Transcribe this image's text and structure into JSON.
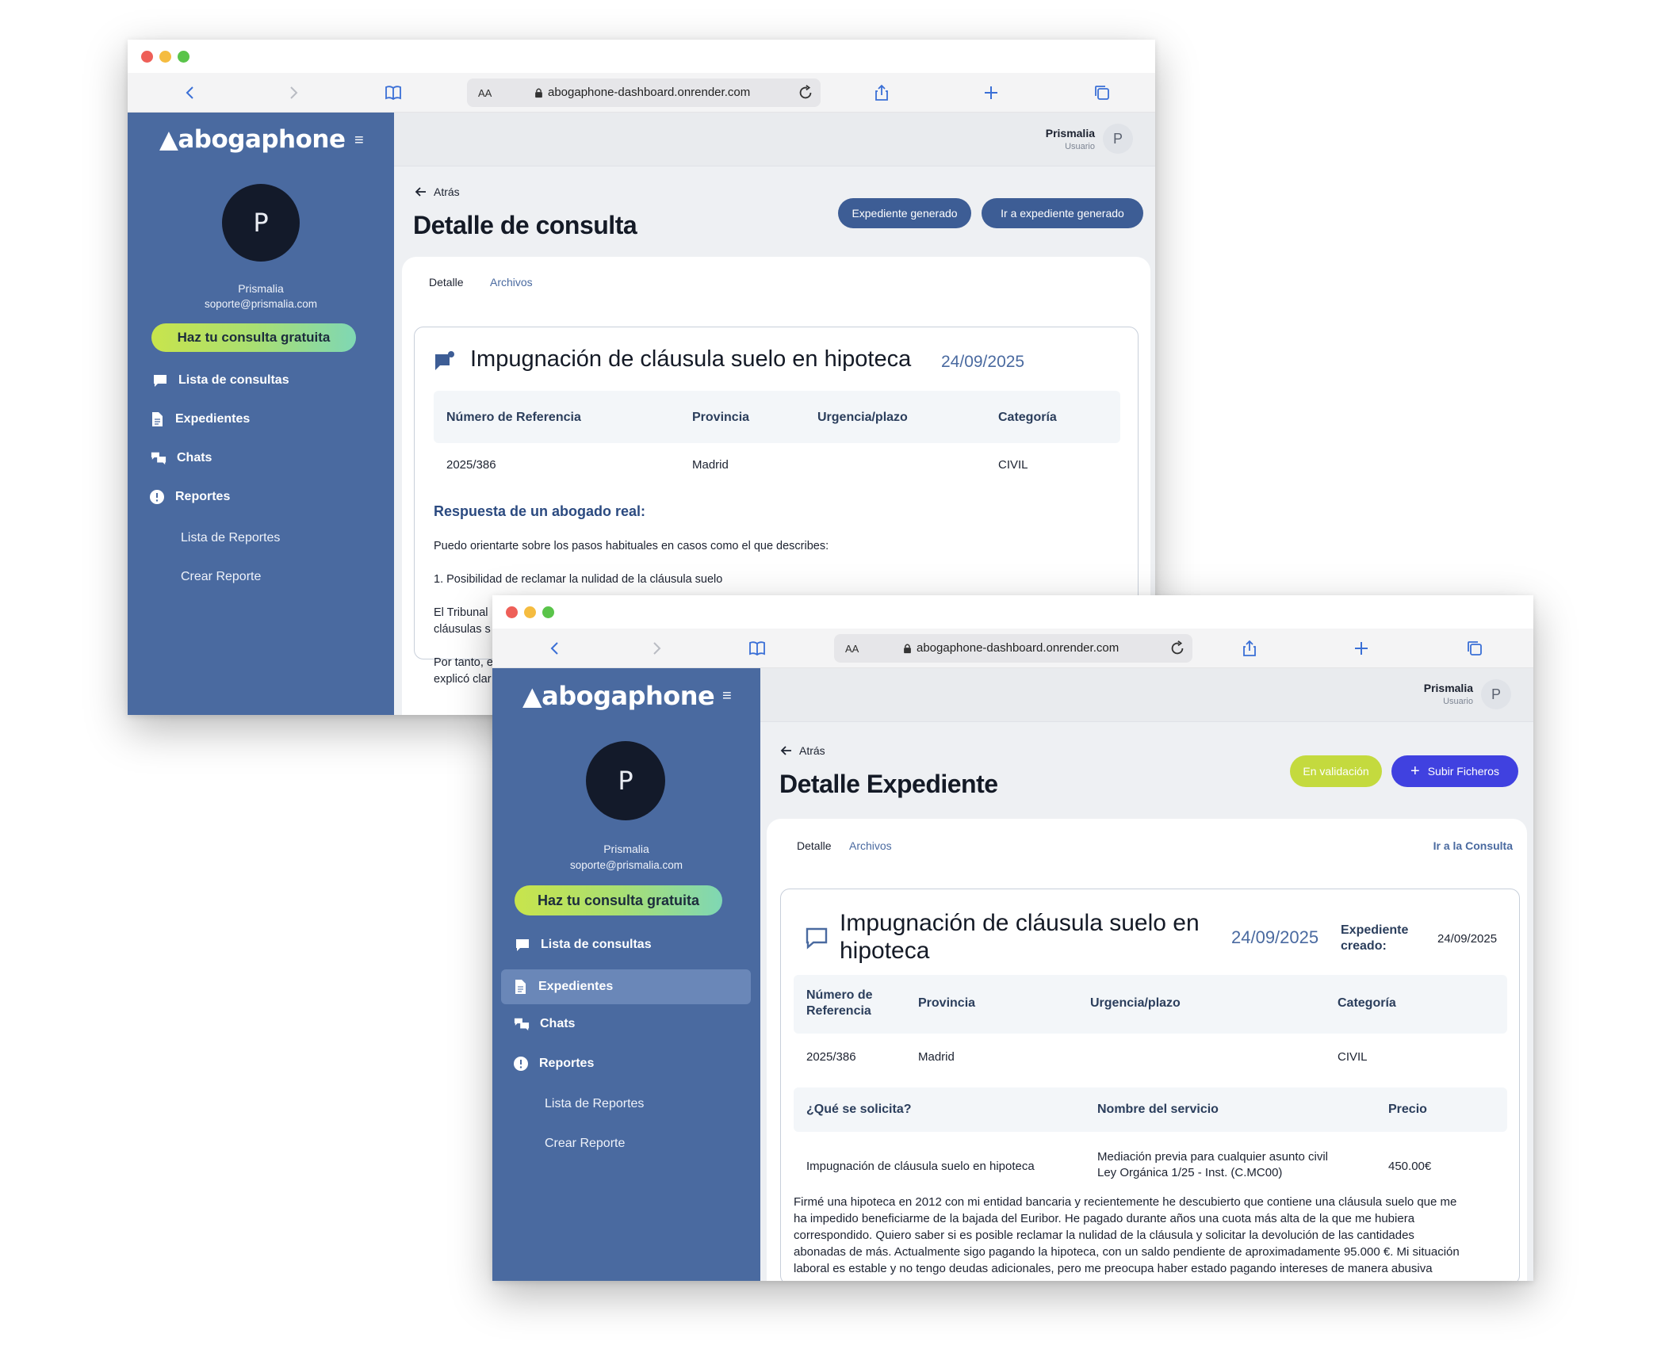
{
  "browser": {
    "url": "abogaphone-dashboard.onrender.com",
    "aa_label": "AA"
  },
  "sidebar": {
    "logo": "abogaphone",
    "avatar_initial": "P",
    "user_name": "Prismalia",
    "user_email": "soporte@prismalia.com",
    "cta": "Haz tu consulta gratuita",
    "items": [
      {
        "label": "Lista de consultas",
        "icon": "chat-bubble-icon"
      },
      {
        "label": "Expedientes",
        "icon": "document-icon"
      },
      {
        "label": "Chats",
        "icon": "chats-icon"
      },
      {
        "label": "Reportes",
        "icon": "alert-circle-icon"
      }
    ],
    "subitems": [
      "Lista de Reportes",
      "Crear Reporte"
    ]
  },
  "topbar": {
    "user_name": "Prismalia",
    "user_role": "Usuario",
    "avatar_initial": "P"
  },
  "consulta": {
    "back": "Atrás",
    "title": "Detalle de consulta",
    "btn_generated": "Expediente generado",
    "btn_goto": "Ir a expediente generado",
    "tabs": [
      "Detalle",
      "Archivos"
    ],
    "card_title": "Impugnación de cláusula suelo en hipoteca",
    "card_date": "24/09/2025",
    "headers": [
      "Número de Referencia",
      "Provincia",
      "Urgencia/plazo",
      "Categoría"
    ],
    "row": [
      "2025/386",
      "Madrid",
      "",
      "CIVIL"
    ],
    "answer_title": "Respuesta de un abogado real:",
    "paragraphs": [
      "Puedo orientarte sobre los pasos habituales en casos como el que describes:",
      "1. Posibilidad de reclamar la nulidad de la cláusula suelo",
      "El Tribunal",
      "cláusulas s",
      "Por tanto, e",
      "explicó clar"
    ]
  },
  "expediente": {
    "back": "Atrás",
    "title": "Detalle Expediente",
    "status": "En validación",
    "upload": "Subir Ficheros",
    "tabs": [
      "Detalle",
      "Archivos"
    ],
    "goto_consulta": "Ir a la Consulta",
    "card_title_line1": "Impugnación de cláusula suelo en",
    "card_title_line2": "hipoteca",
    "card_date": "24/09/2025",
    "created_label_1": "Expediente",
    "created_label_2": "creado:",
    "created_date": "24/09/2025",
    "headers": [
      "Número de",
      "Referencia",
      "Provincia",
      "Urgencia/plazo",
      "Categoría"
    ],
    "row": [
      "2025/386",
      "Madrid",
      "",
      "CIVIL"
    ],
    "headers2": [
      "¿Qué se solicita?",
      "Nombre del servicio",
      "Precio"
    ],
    "row2": {
      "request": "Impugnación de cláusula suelo en hipoteca",
      "service_1": "Mediación previa para cualquier asunto civil",
      "service_2": "Ley Orgánica 1/25 - Inst. (C.MC00)",
      "price": "450.00€"
    },
    "description": [
      "Firmé una hipoteca en 2012 con mi entidad bancaria y recientemente he descubierto que contiene una cláusula suelo que me",
      "ha impedido beneficiarme de la bajada del Euribor. He pagado durante años una cuota más alta de la que me hubiera",
      "correspondido. Quiero saber si es posible reclamar la nulidad de la cláusula y solicitar la devolución de las cantidades",
      "abonadas de más. Actualmente sigo pagando la hipoteca, con un saldo pendiente de aproximadamente 95.000 €. Mi situación",
      "laboral es estable y no tengo deudas adicionales, pero me preocupa haber estado pagando intereses de manera abusiva"
    ]
  },
  "colors": {
    "sidebar": "#4a6aa0",
    "navy_button": "#3d5d95",
    "lime_button": "#c4da3e",
    "blue_button": "#4041e0"
  }
}
